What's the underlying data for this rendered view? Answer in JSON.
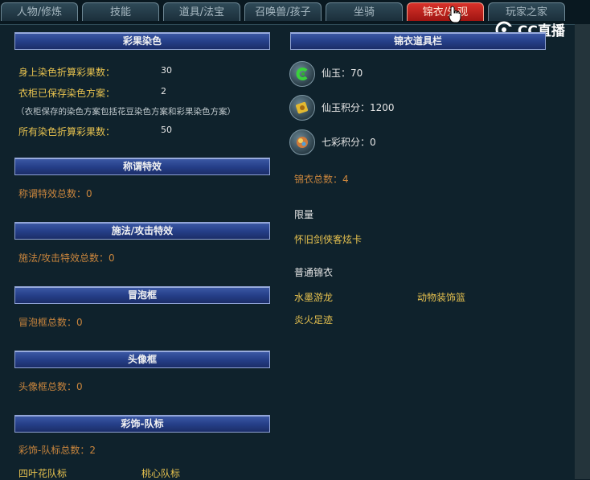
{
  "tabs": [
    {
      "label": "人物/修炼"
    },
    {
      "label": "技能"
    },
    {
      "label": "道具/法宝"
    },
    {
      "label": "召唤兽/孩子"
    },
    {
      "label": "坐骑"
    },
    {
      "label": "锦衣/外观"
    },
    {
      "label": "玩家之家"
    }
  ],
  "active_tab": "锦衣/外观",
  "watermark": {
    "text": "CC直播"
  },
  "left": {
    "dye": {
      "title": "彩果染色",
      "row1_label": "身上染色折算彩果数：",
      "row1_value": "30",
      "row2_label": "衣柜已保存染色方案：",
      "row2_value": "2",
      "note": "（衣柜保存的染色方案包括花豆染色方案和彩果染色方案）",
      "row3_label": "所有染色折算彩果数：",
      "row3_value": "50"
    },
    "title_effect": {
      "title": "称谓特效",
      "summary": "称谓特效总数：0"
    },
    "cast_effect": {
      "title": "施法/攻击特效",
      "summary": "施法/攻击特效总数：0"
    },
    "bubble": {
      "title": "冒泡框",
      "summary": "冒泡框总数：0"
    },
    "avatar_frame": {
      "title": "头像框",
      "summary": "头像框总数：0"
    },
    "team_badge": {
      "title": "彩饰-队标",
      "summary": "彩饰-队标总数：2",
      "items": [
        "四叶花队标",
        "桃心队标"
      ]
    }
  },
  "right": {
    "title": "锦衣道具栏",
    "items": [
      {
        "icon": "jade-icon",
        "text": "仙玉：70"
      },
      {
        "icon": "card-icon",
        "text": "仙玉积分：1200"
      },
      {
        "icon": "rainbow-orb-icon",
        "text": "七彩积分：0"
      }
    ],
    "total": "锦衣总数：4",
    "limited": {
      "heading": "限量",
      "items": [
        "怀旧剑侠客炫卡"
      ]
    },
    "normal": {
      "heading": "普通锦衣",
      "items": [
        "水墨游龙",
        "动物装饰篮",
        "炎火足迹"
      ]
    }
  }
}
